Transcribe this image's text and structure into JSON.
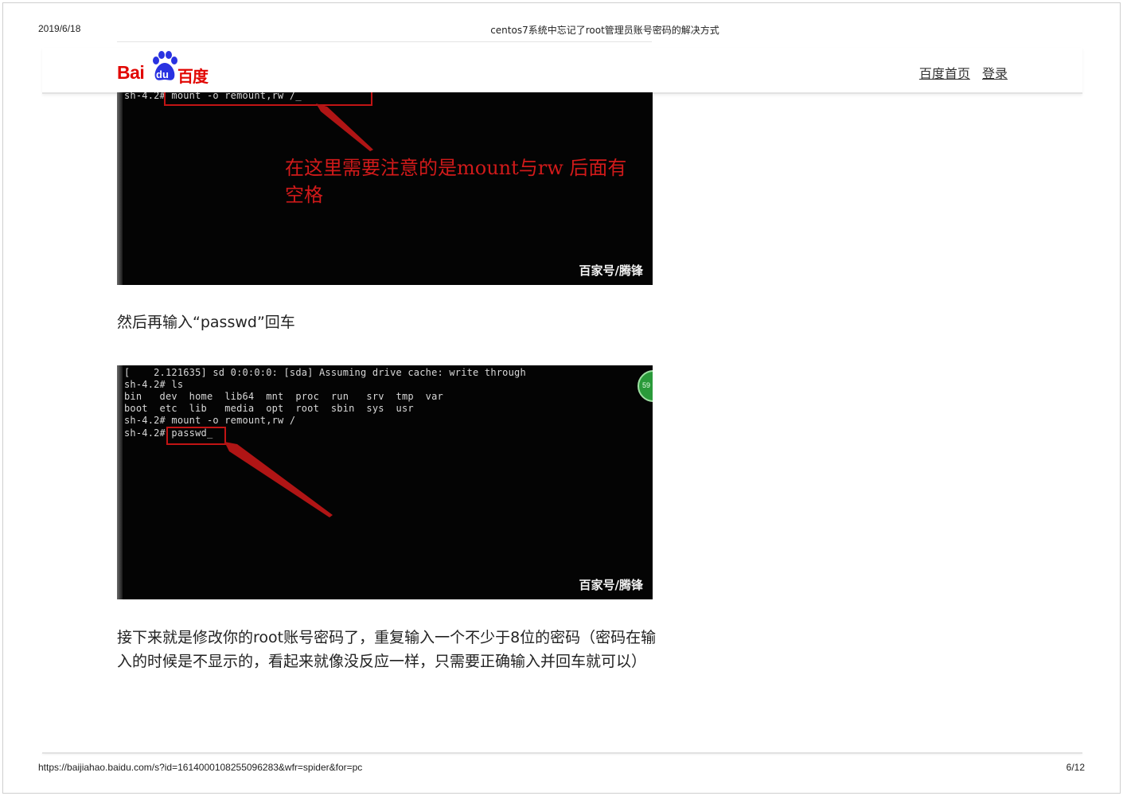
{
  "print_header": {
    "date": "2019/6/18",
    "title": "centos7系统中忘记了root管理员账号密码的解决方式"
  },
  "site": {
    "logo_latin": "Bai",
    "logo_du": "du",
    "logo_chinese": "百度",
    "nav": {
      "home": "百度首页",
      "login": "登录"
    }
  },
  "screenshot1": {
    "terminal_lines": [
      "sh-4.2# mount -o remount,rw /_"
    ],
    "annotation": "在这里需要注意的是mount与rw 后面有空格",
    "watermark": "百家号/腾锋"
  },
  "paragraph1": "然后再输入“passwd”回车",
  "screenshot2": {
    "terminal_lines": [
      "[    2.121635] sd 0:0:0:0: [sda] Assuming drive cache: write through",
      "sh-4.2# ls",
      "bin   dev  home  lib64  mnt  proc  run   srv  tmp  var",
      "boot  etc  lib   media  opt  root  sbin  sys  usr",
      "sh-4.2# mount -o remount,rw /",
      "sh-4.2# passwd_"
    ],
    "badge": "59",
    "watermark": "百家号/腾锋"
  },
  "paragraph2": "接下来就是修改你的root账号密码了，重复输入一个不少于8位的密码（密码在输入的时候是不显示的，看起来就像没反应一样，只需要正确输入并回车就可以）",
  "print_footer": {
    "url": "https://baijiahao.baidu.com/s?id=1614000108255096283&wfr=spider&for=pc",
    "page": "6/12"
  },
  "colors": {
    "brand_red": "#e10602",
    "brand_blue": "#2932e1",
    "annotation_red": "#d11a1a"
  }
}
